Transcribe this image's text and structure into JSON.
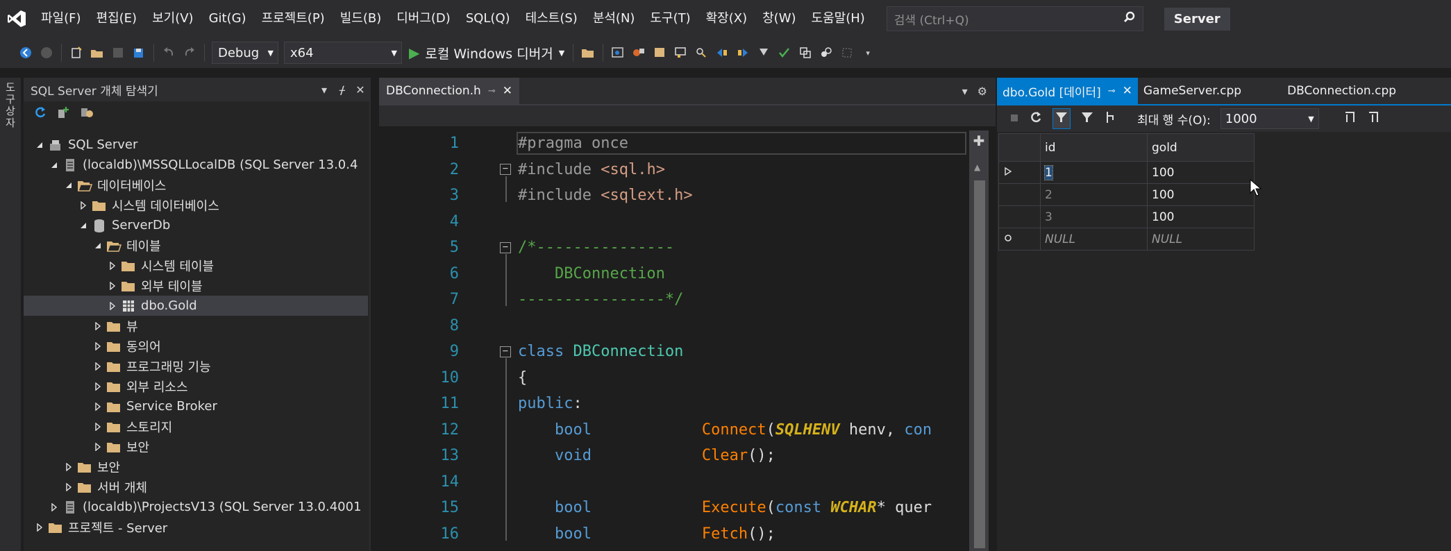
{
  "menubar": {
    "items": [
      "파일(F)",
      "편집(E)",
      "보기(V)",
      "Git(G)",
      "프로젝트(P)",
      "빌드(B)",
      "디버그(D)",
      "SQL(Q)",
      "테스트(S)",
      "분석(N)",
      "도구(T)",
      "확장(X)",
      "창(W)",
      "도움말(H)"
    ],
    "search_placeholder": "검색 (Ctrl+Q)",
    "solution_name": "Server"
  },
  "toolbar": {
    "config": "Debug",
    "platform": "x64",
    "run_label": "로컬 Windows 디버거"
  },
  "leftstrip": {
    "label": "도구 상자"
  },
  "explorer": {
    "title": "SQL Server 개체 탐색기",
    "nodes": [
      {
        "label": "SQL Server",
        "arrow": "down",
        "icon": "server",
        "level": 0
      },
      {
        "label": "(localdb)\\MSSQLLocalDB (SQL Server 13.0.4",
        "arrow": "down",
        "icon": "db-server",
        "level": 1
      },
      {
        "label": "데이터베이스",
        "arrow": "down",
        "icon": "folder-open",
        "level": 2
      },
      {
        "label": "시스템 데이터베이스",
        "arrow": "right",
        "icon": "folder",
        "level": 3
      },
      {
        "label": "ServerDb",
        "arrow": "down",
        "icon": "database",
        "level": 3
      },
      {
        "label": "테이블",
        "arrow": "down",
        "icon": "folder-open",
        "level": 4
      },
      {
        "label": "시스템 테이블",
        "arrow": "right",
        "icon": "folder",
        "level": 5
      },
      {
        "label": "외부 테이블",
        "arrow": "right",
        "icon": "folder",
        "level": 5
      },
      {
        "label": "dbo.Gold",
        "arrow": "right",
        "icon": "table",
        "level": 5,
        "selected": true
      },
      {
        "label": "뷰",
        "arrow": "right",
        "icon": "folder",
        "level": 4
      },
      {
        "label": "동의어",
        "arrow": "right",
        "icon": "folder",
        "level": 4
      },
      {
        "label": "프로그래밍 기능",
        "arrow": "right",
        "icon": "folder",
        "level": 4
      },
      {
        "label": "외부 리소스",
        "arrow": "right",
        "icon": "folder",
        "level": 4
      },
      {
        "label": "Service Broker",
        "arrow": "right",
        "icon": "folder",
        "level": 4
      },
      {
        "label": "스토리지",
        "arrow": "right",
        "icon": "folder",
        "level": 4
      },
      {
        "label": "보안",
        "arrow": "right",
        "icon": "folder",
        "level": 4
      },
      {
        "label": "보안",
        "arrow": "right",
        "icon": "folder",
        "level": 2
      },
      {
        "label": "서버 개체",
        "arrow": "right",
        "icon": "folder",
        "level": 2
      },
      {
        "label": "(localdb)\\ProjectsV13 (SQL Server 13.0.4001",
        "arrow": "right",
        "icon": "db-server",
        "level": 1
      },
      {
        "label": "프로젝트 - Server",
        "arrow": "right",
        "icon": "folder",
        "level": 0
      }
    ]
  },
  "editor": {
    "tab_label": "DBConnection.h",
    "lines": [
      {
        "n": "1",
        "tokens": [
          [
            "pre",
            "#pragma once"
          ]
        ]
      },
      {
        "n": "2",
        "fold": true,
        "tokens": [
          [
            "pre",
            "#include "
          ],
          [
            "str",
            "<sql.h>"
          ]
        ]
      },
      {
        "n": "3",
        "tokens": [
          [
            "pre",
            "#include "
          ],
          [
            "str",
            "<sqlext.h>"
          ]
        ]
      },
      {
        "n": "4",
        "tokens": []
      },
      {
        "n": "5",
        "fold": true,
        "tokens": [
          [
            "com",
            "/*---------------"
          ]
        ]
      },
      {
        "n": "6",
        "tokens": [
          [
            "com",
            "    DBConnection"
          ]
        ]
      },
      {
        "n": "7",
        "tokens": [
          [
            "com",
            "----------------*/"
          ]
        ]
      },
      {
        "n": "8",
        "tokens": []
      },
      {
        "n": "9",
        "fold": true,
        "tokens": [
          [
            "kw",
            "class "
          ],
          [
            "type",
            "DBConnection"
          ]
        ]
      },
      {
        "n": "10",
        "tokens": [
          [
            "plain",
            "{"
          ]
        ]
      },
      {
        "n": "11",
        "tokens": [
          [
            "kw",
            "public"
          ],
          [
            "plain",
            ":"
          ]
        ]
      },
      {
        "n": "12",
        "tokens": [
          [
            "plain",
            "    "
          ],
          [
            "kw",
            "bool"
          ],
          [
            "plain",
            "            "
          ],
          [
            "fn",
            "Connect"
          ],
          [
            "plain",
            "("
          ],
          [
            "mac",
            "SQLHENV"
          ],
          [
            "plain",
            " henv, "
          ],
          [
            "kw",
            "con"
          ]
        ]
      },
      {
        "n": "13",
        "tokens": [
          [
            "plain",
            "    "
          ],
          [
            "kw",
            "void"
          ],
          [
            "plain",
            "            "
          ],
          [
            "fn",
            "Clear"
          ],
          [
            "plain",
            "();"
          ]
        ]
      },
      {
        "n": "14",
        "tokens": []
      },
      {
        "n": "15",
        "tokens": [
          [
            "plain",
            "    "
          ],
          [
            "kw",
            "bool"
          ],
          [
            "plain",
            "            "
          ],
          [
            "fn",
            "Execute"
          ],
          [
            "plain",
            "("
          ],
          [
            "kw",
            "const "
          ],
          [
            "mac",
            "WCHAR"
          ],
          [
            "plain",
            "* "
          ],
          [
            "plain",
            "quer"
          ]
        ]
      },
      {
        "n": "16",
        "tokens": [
          [
            "plain",
            "    "
          ],
          [
            "kw",
            "bool"
          ],
          [
            "plain",
            "            "
          ],
          [
            "fn",
            "Fetch"
          ],
          [
            "plain",
            "();"
          ]
        ]
      }
    ]
  },
  "datapanel": {
    "tabs": [
      "dbo.Gold [데이터]",
      "GameServer.cpp",
      "DBConnection.cpp"
    ],
    "max_rows_label": "최대 행 수(O):",
    "max_rows_value": "1000",
    "columns": [
      "id",
      "gold"
    ],
    "rows": [
      {
        "id": "1",
        "gold": "100"
      },
      {
        "id": "2",
        "gold": "100"
      },
      {
        "id": "3",
        "gold": "100"
      },
      {
        "id": "NULL",
        "gold": "NULL"
      }
    ]
  }
}
